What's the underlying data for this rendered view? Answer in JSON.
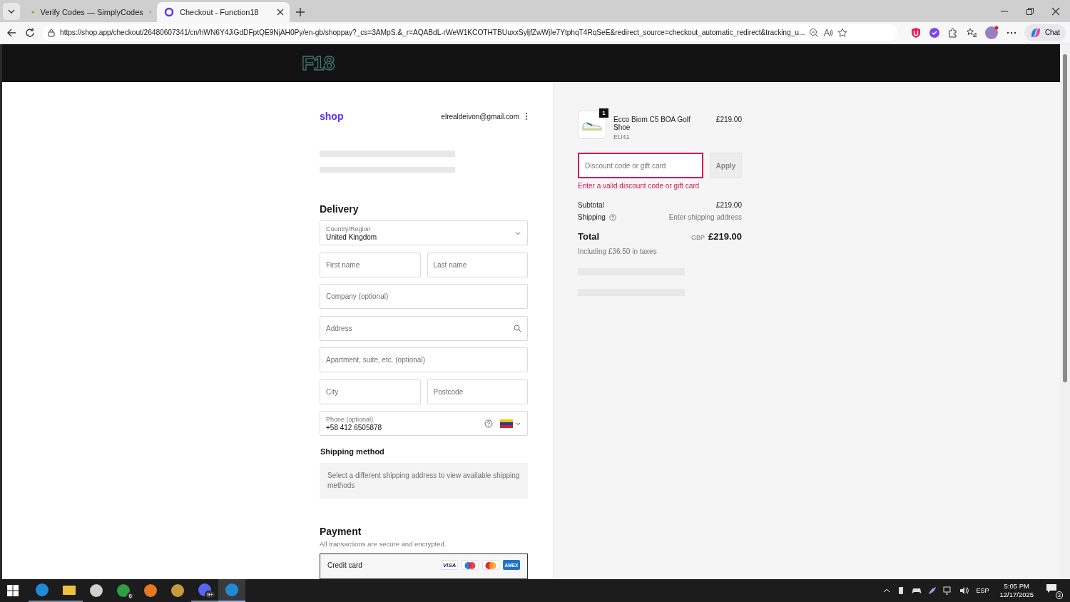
{
  "browser": {
    "tabs": [
      {
        "title": "Verify Codes — SimplyCodes",
        "kind": "simplycodes",
        "selected": false
      },
      {
        "title": "Checkout - Function18",
        "kind": "shop",
        "selected": true
      }
    ],
    "url": "https://shop.app/checkout/26480607341/cn/hWN6Y4JiGdDFptQE9NjAH0Py/en-gb/shoppay?_cs=3AMpS.&_r=AQABdL-rWeW1KCOTHTBUuxxSyljfZwWjIe7YtphqT4RqSeE&redirect_source=checkout_automatic_redirect&tracking_u...",
    "chat_label": "Chat"
  },
  "store": {
    "logo": "F18"
  },
  "checkout": {
    "brand": "shop",
    "email": "elrealdeivon@gmail.com",
    "delivery": {
      "heading": "Delivery",
      "rows": [
        [
          {
            "kind": "select",
            "label": "Country/Region",
            "value": "United Kingdom"
          }
        ],
        [
          {
            "kind": "text",
            "placeholder": "First name"
          },
          {
            "kind": "text",
            "placeholder": "Last name"
          }
        ],
        [
          {
            "kind": "text",
            "placeholder": "Company (optional)"
          }
        ],
        [
          {
            "kind": "search",
            "placeholder": "Address"
          }
        ],
        [
          {
            "kind": "text",
            "placeholder": "Apartment, suite, etc. (optional)"
          }
        ],
        [
          {
            "kind": "text",
            "placeholder": "City"
          },
          {
            "kind": "text",
            "placeholder": "Postcode"
          }
        ],
        [
          {
            "kind": "phone",
            "label": "Phone (optional)",
            "value": "+58 412 6505878"
          }
        ]
      ]
    },
    "shipping_method": {
      "heading": "Shipping method",
      "message": "Select a different shipping address to view available shipping methods"
    },
    "payment": {
      "heading": "Payment",
      "note": "All transactions are secure and encrypted.",
      "method": {
        "label": "Credit card",
        "selected": true
      },
      "card_brands": [
        {
          "kind": "visa",
          "label": "VISA"
        },
        {
          "kind": "maestro"
        },
        {
          "kind": "mastercard"
        },
        {
          "kind": "amex",
          "label": "AMEX"
        }
      ]
    }
  },
  "summary": {
    "product": {
      "name": "Ecco Biom C5 BOA Golf Shoe",
      "variant": "EU41",
      "price": "£219.00",
      "quantity": "1"
    },
    "discount": {
      "placeholder": "Discount code or gift card",
      "error": true,
      "error_message": "Enter a valid discount code or gift card",
      "button": "Apply",
      "button_disabled": true
    },
    "subtotal": {
      "label": "Subtotal",
      "value": "£219.00"
    },
    "shipping": {
      "label": "Shipping",
      "value": "Enter shipping address"
    },
    "total": {
      "label": "Total",
      "currency": "GBP",
      "value": "£219.00"
    },
    "taxes_note": "Including £36.50 in taxes"
  },
  "taskbar": {
    "apps": [
      {
        "kind": "edge",
        "running": true,
        "selected": false
      },
      {
        "kind": "files",
        "running": true,
        "selected": false
      },
      {
        "kind": "obs",
        "running": false,
        "selected": false
      },
      {
        "kind": "xbox",
        "running": false,
        "selected": false,
        "badge": "6"
      },
      {
        "kind": "fruity",
        "running": false,
        "selected": false
      },
      {
        "kind": "league",
        "running": false,
        "selected": false
      },
      {
        "kind": "discord",
        "running": true,
        "selected": false,
        "badge": "9+"
      },
      {
        "kind": "edge",
        "running": true,
        "selected": true
      }
    ],
    "language": "ESP",
    "time": "5:05 PM",
    "date": "12/17/2025",
    "notifications": "3"
  }
}
